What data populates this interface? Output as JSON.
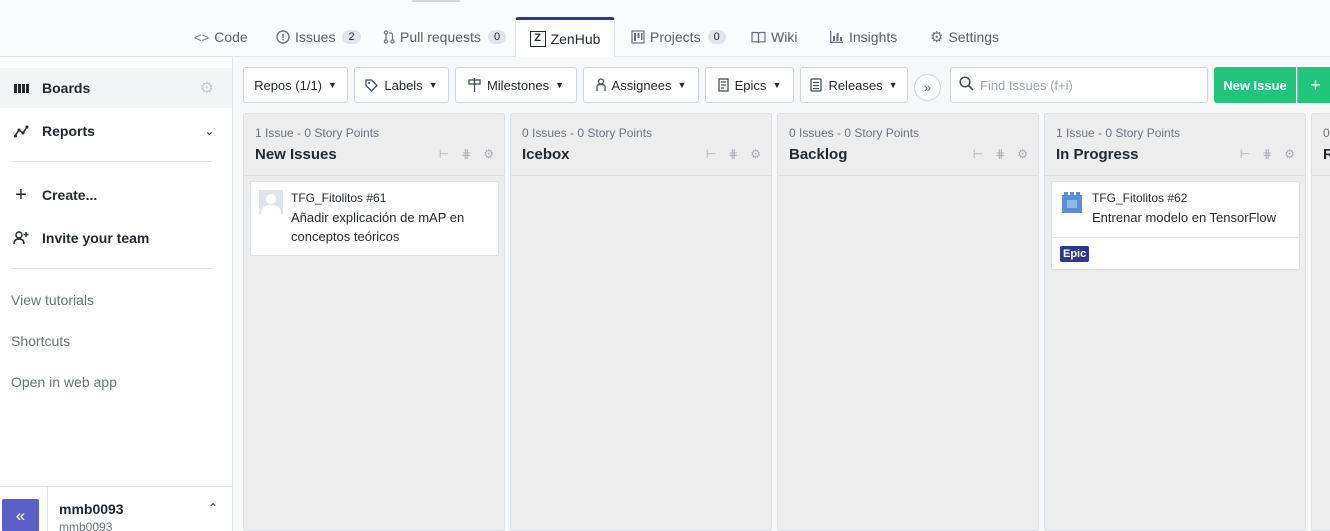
{
  "tabs": [
    {
      "label": "Code",
      "icon": "code-icon"
    },
    {
      "label": "Issues",
      "icon": "issue-opened-icon",
      "count": "2"
    },
    {
      "label": "Pull requests",
      "icon": "git-pull-request-icon",
      "count": "0"
    },
    {
      "label": "ZenHub",
      "icon": "zenhub-logo-icon",
      "active": true
    },
    {
      "label": "Projects",
      "icon": "project-icon",
      "count": "0"
    },
    {
      "label": "Wiki",
      "icon": "book-icon"
    },
    {
      "label": "Insights",
      "icon": "graph-icon"
    },
    {
      "label": "Settings",
      "icon": "gear-icon"
    }
  ],
  "sidebar": {
    "boards": "Boards",
    "reports": "Reports",
    "create": "Create...",
    "invite": "Invite your team",
    "view_tutorials": "View tutorials",
    "shortcuts": "Shortcuts",
    "open_web_app": "Open in web app",
    "user_name": "mmb0093",
    "user_sub": "mmb0093"
  },
  "toolbar": {
    "repos": "Repos (1/1)",
    "labels": "Labels",
    "milestones": "Milestones",
    "assignees": "Assignees",
    "epics": "Epics",
    "releases": "Releases",
    "search_placeholder": "Find Issues (f+i)",
    "new_issue": "New Issue"
  },
  "pipelines": [
    {
      "name": "New Issues",
      "meta": "1 Issue - 0 Story Points",
      "cards": [
        {
          "repo": "TFG_Fitolitos #61",
          "title": "Añadir explicación de mAP en conceptos teóricos"
        }
      ]
    },
    {
      "name": "Icebox",
      "meta": "0 Issues - 0 Story Points",
      "cards": []
    },
    {
      "name": "Backlog",
      "meta": "0 Issues - 0 Story Points",
      "cards": []
    },
    {
      "name": "In Progress",
      "meta": "1 Issue - 0 Story Points",
      "cards": [
        {
          "repo": "TFG_Fitolitos #62",
          "title": "Entrenar modelo en TensorFlow",
          "badge": "Epic"
        }
      ]
    },
    {
      "name": "R",
      "meta": "0",
      "cards": []
    }
  ],
  "colors": {
    "accent": "#2b3990",
    "new_issue_green": "#21c57b",
    "collapse_purple": "#5b5fc7"
  }
}
